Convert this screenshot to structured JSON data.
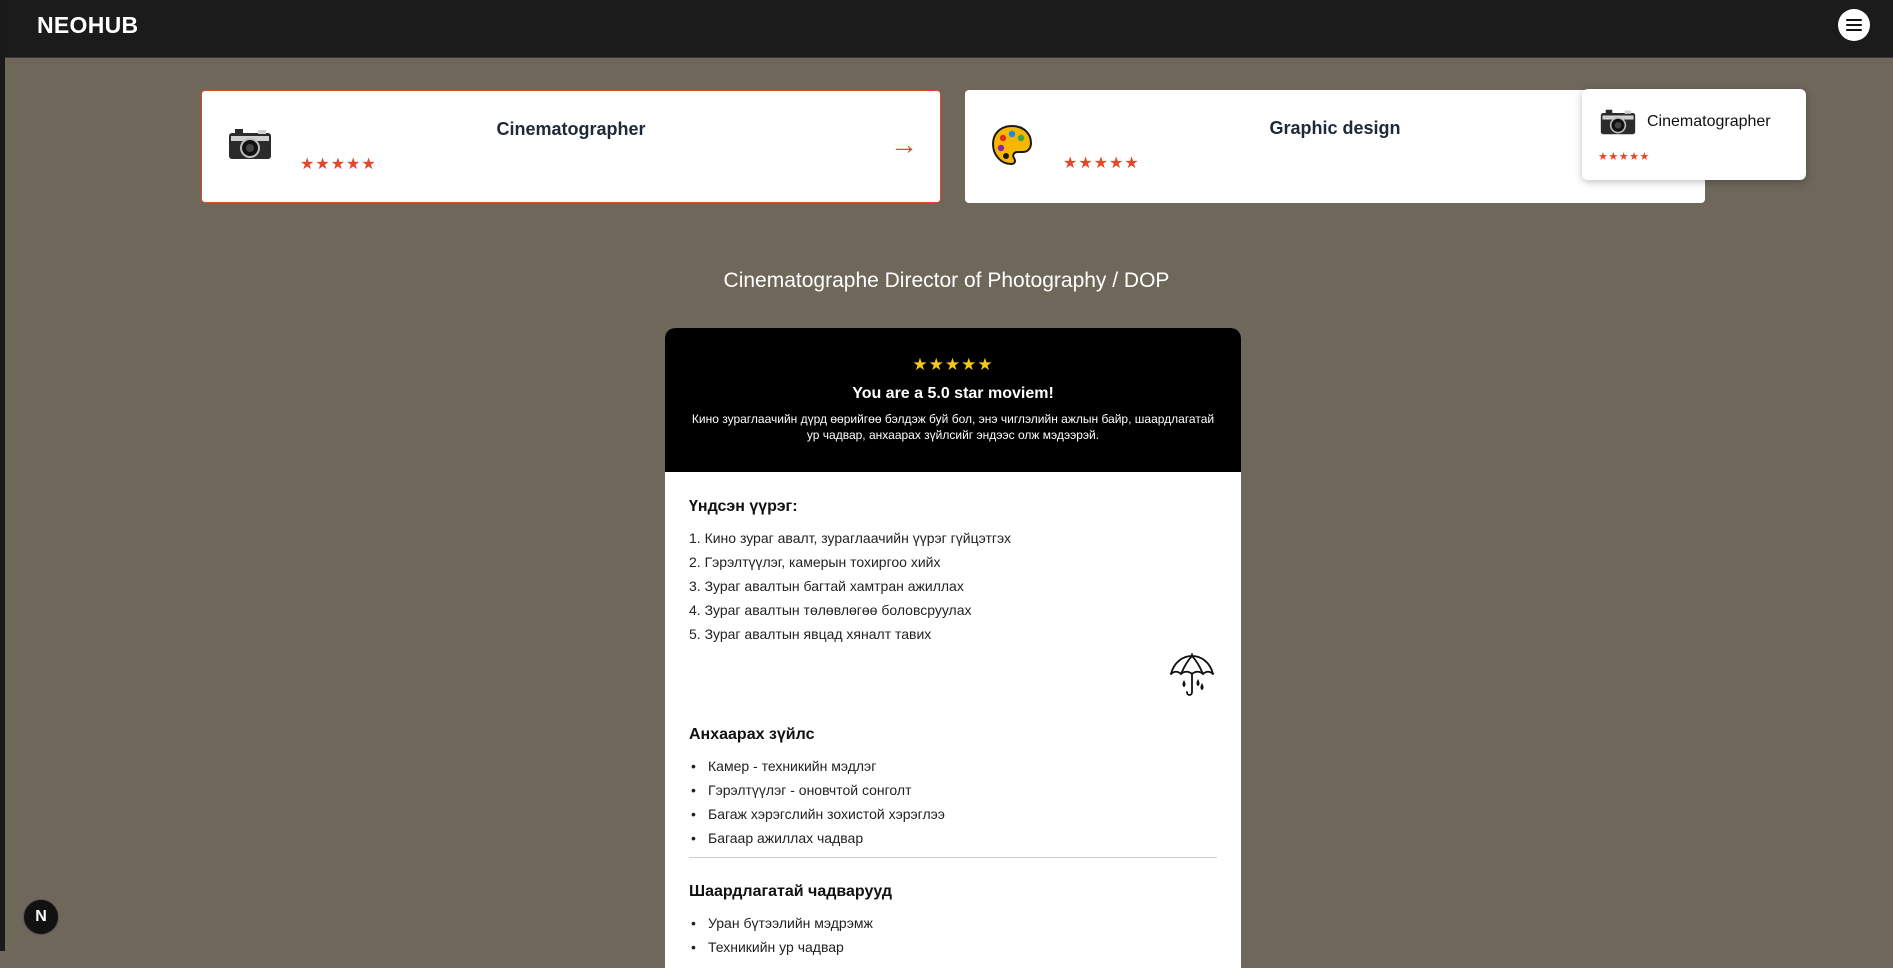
{
  "navbar": {
    "brand": "NEOHUB",
    "menu_icon": "hamburger-menu-icon"
  },
  "cards": [
    {
      "title": "Cinematographer",
      "stars": "★★★★★",
      "icon": "camera-icon",
      "arrow": "→",
      "active": true
    },
    {
      "title": "Graphic design",
      "stars": "★★★★★",
      "icon": "palette-icon",
      "active": false
    }
  ],
  "popup": {
    "label": "Cinematographer",
    "stars": "★★★★★",
    "icon": "camera-icon"
  },
  "section_title": "Cinematographe Director of Photography / DOP",
  "detail": {
    "stars": "★★★★★",
    "headline": "You are a 5.0 star moviem!",
    "description": "Кино зураглаачийн дүрд өөрийгөө бэлдэж буй бол, энэ чиглэлийн ажлын байр, шаардлагатай ур чадвар, анхаарах зүйлсийг эндээс олж мэдээрэй.",
    "main_role": {
      "heading": "Үндсэн үүрэг:",
      "items": [
        "1. Кино зураг авалт, зураглаачийн үүрэг гүйцэтгэх",
        "2. Гэрэлтүүлэг, камерын тохиргоо хийх",
        "3. Зураг авалтын багтай хамтран ажиллах",
        "4. Зураг авалтын төлөвлөгөө боловсруулах",
        "5. Зураг авалтын явцад хяналт тавих"
      ]
    },
    "umbrella_icon": "umbrella-icon",
    "attention": {
      "heading": "Анхаарах зүйлс",
      "items": [
        "Камер - техникийн мэдлэг",
        "Гэрэлтүүлэг - оновчтой сонголт",
        "Багаж хэрэгслийн зохистой хэрэглээ",
        "Багаар ажиллах чадвар"
      ]
    },
    "skills": {
      "heading": "Шаардлагатай чадварууд",
      "items": [
        "Уран бүтээлийн мэдрэмж",
        "Техникийн ур чадвар"
      ]
    }
  },
  "next_badge": {
    "letter": "N"
  },
  "colors": {
    "accent": "#e2482c",
    "gold": "#f5c518",
    "background": "#6e675a",
    "nav": "#1b1b1b"
  }
}
